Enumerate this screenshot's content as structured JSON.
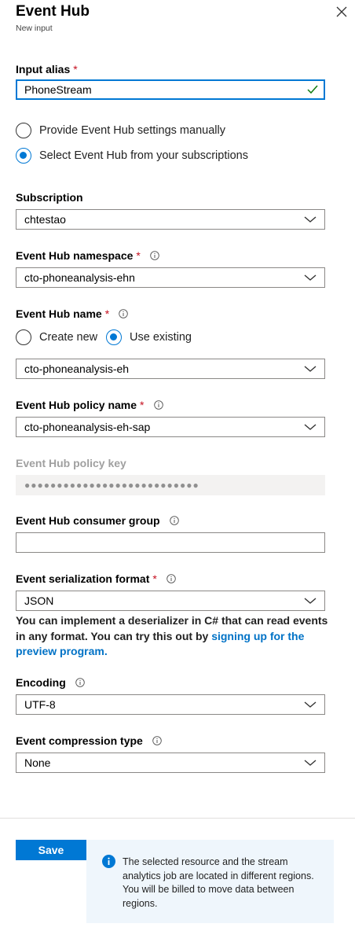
{
  "blade": {
    "title": "Event Hub",
    "subtitle": "New input"
  },
  "input_alias": {
    "label": "Input alias",
    "required": "*",
    "value": "PhoneStream"
  },
  "settings_mode": {
    "options": [
      {
        "label": "Provide Event Hub settings manually",
        "checked": false
      },
      {
        "label": "Select Event Hub from your subscriptions",
        "checked": true
      }
    ]
  },
  "subscription": {
    "label": "Subscription",
    "value": "chtestao"
  },
  "namespace": {
    "label": "Event Hub namespace",
    "required": "*",
    "value": "cto-phoneanalysis-ehn"
  },
  "hub_name": {
    "label": "Event Hub name",
    "required": "*",
    "options": [
      {
        "label": "Create new",
        "checked": false
      },
      {
        "label": "Use existing",
        "checked": true
      }
    ],
    "value": "cto-phoneanalysis-eh"
  },
  "policy_name": {
    "label": "Event Hub policy name",
    "required": "*",
    "value": "cto-phoneanalysis-eh-sap"
  },
  "policy_key": {
    "label": "Event Hub policy key",
    "value": "●●●●●●●●●●●●●●●●●●●●●●●●●●●"
  },
  "consumer_group": {
    "label": "Event Hub consumer group",
    "value": ""
  },
  "serialization": {
    "label": "Event serialization format",
    "required": "*",
    "value": "JSON",
    "note_text": "You can implement a deserializer in C# that can read events in any format. You can try this out by ",
    "note_link": "signing up for the preview program."
  },
  "encoding": {
    "label": "Encoding",
    "value": "UTF-8"
  },
  "compression": {
    "label": "Event compression type",
    "value": "None"
  },
  "footer": {
    "save_label": "Save",
    "info_message": "The selected resource and the stream analytics job are located in different regions. You will be billed to move data between regions."
  },
  "colors": {
    "accent": "#0078d4",
    "required": "#c50f1f",
    "valid_check": "#107c10",
    "info_bg": "#eff6fc"
  },
  "icons": [
    "close-icon",
    "checkmark-icon",
    "info-icon",
    "chevron-down-icon"
  ]
}
